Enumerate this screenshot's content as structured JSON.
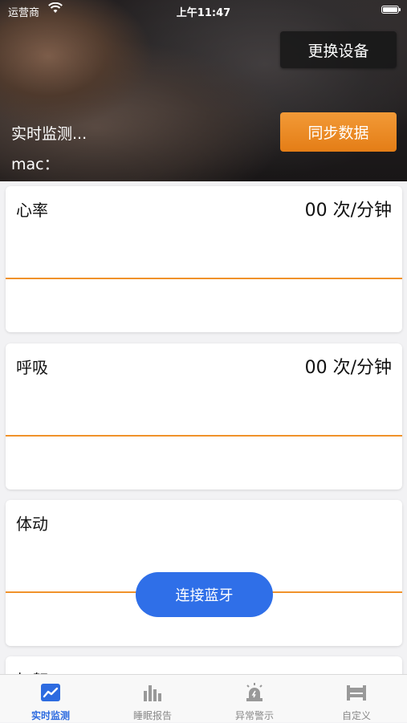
{
  "status_bar": {
    "carrier": "运营商",
    "time": "上午11:47"
  },
  "header": {
    "switch_device_label": "更换设备",
    "sync_data_label": "同步数据",
    "monitor_title": "实时监测...",
    "mac_label": "mac："
  },
  "cards": {
    "heart_rate": {
      "title": "心率",
      "value": "00 次/分钟"
    },
    "breathing": {
      "title": "呼吸",
      "value": "00 次/分钟"
    },
    "movement": {
      "title": "体动",
      "connect_bluetooth_label": "连接蓝牙"
    },
    "snoring": {
      "title": "打鼾"
    }
  },
  "tabbar": {
    "items": [
      {
        "label": "实时监测",
        "icon": "chart-line-icon",
        "active": true
      },
      {
        "label": "睡眠报告",
        "icon": "bar-chart-icon",
        "active": false
      },
      {
        "label": "异常警示",
        "icon": "alarm-light-icon",
        "active": false
      },
      {
        "label": "自定义",
        "icon": "bed-icon",
        "active": false
      }
    ]
  },
  "colors": {
    "accent_orange": "#e47d16",
    "line_orange": "#f0922a",
    "primary_blue": "#2f6fe8",
    "tab_active": "#2d6be0",
    "tab_inactive": "#888888"
  }
}
